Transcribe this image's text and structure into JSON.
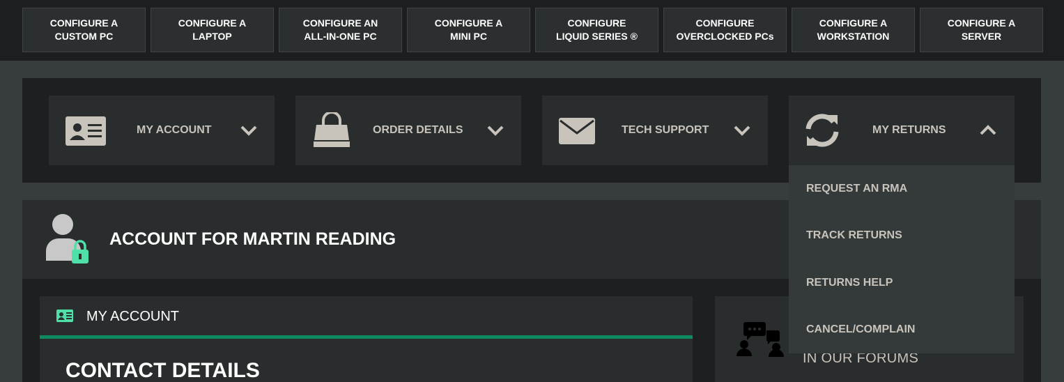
{
  "configure_bar": [
    {
      "line1": "CONFIGURE A",
      "line2": "CUSTOM PC"
    },
    {
      "line1": "CONFIGURE A",
      "line2": "LAPTOP"
    },
    {
      "line1": "CONFIGURE AN",
      "line2": "ALL-IN-ONE PC"
    },
    {
      "line1": "CONFIGURE A",
      "line2": "MINI PC"
    },
    {
      "line1": "CONFIGURE",
      "line2": "LIQUID SERIES ®"
    },
    {
      "line1": "CONFIGURE",
      "line2": "OVERCLOCKED PCs"
    },
    {
      "line1": "CONFIGURE A",
      "line2": "WORKSTATION"
    },
    {
      "line1": "CONFIGURE A",
      "line2": "SERVER"
    }
  ],
  "account_nav": [
    {
      "label": "MY ACCOUNT",
      "icon": "id-card-icon",
      "chevron": "chevron-down-icon"
    },
    {
      "label": "ORDER DETAILS",
      "icon": "shopping-bag-icon",
      "chevron": "chevron-down-icon"
    },
    {
      "label": "TECH SUPPORT",
      "icon": "envelope-icon",
      "chevron": "chevron-down-icon"
    },
    {
      "label": "MY RETURNS",
      "icon": "refresh-icon",
      "chevron": "chevron-up-icon"
    }
  ],
  "returns_dropdown": [
    "REQUEST AN RMA",
    "TRACK RETURNS",
    "RETURNS HELP",
    "CANCEL/COMPLAIN"
  ],
  "account_header": {
    "title": "ACCOUNT FOR MARTIN READING",
    "icon": "user-lock-icon"
  },
  "my_account_panel": {
    "title": "MY ACCOUNT",
    "icon": "id-card-icon",
    "section_title": "CONTACT DETAILS"
  },
  "forum_panel": {
    "text": "IN OUR FORUMS",
    "icon": "forum-users-icon"
  },
  "colors": {
    "accent_green": "#0d8a5e",
    "icon_green": "#4ee0a8",
    "nav_text": "#c8c4bb",
    "icon_beige": "#c8c4bb"
  }
}
